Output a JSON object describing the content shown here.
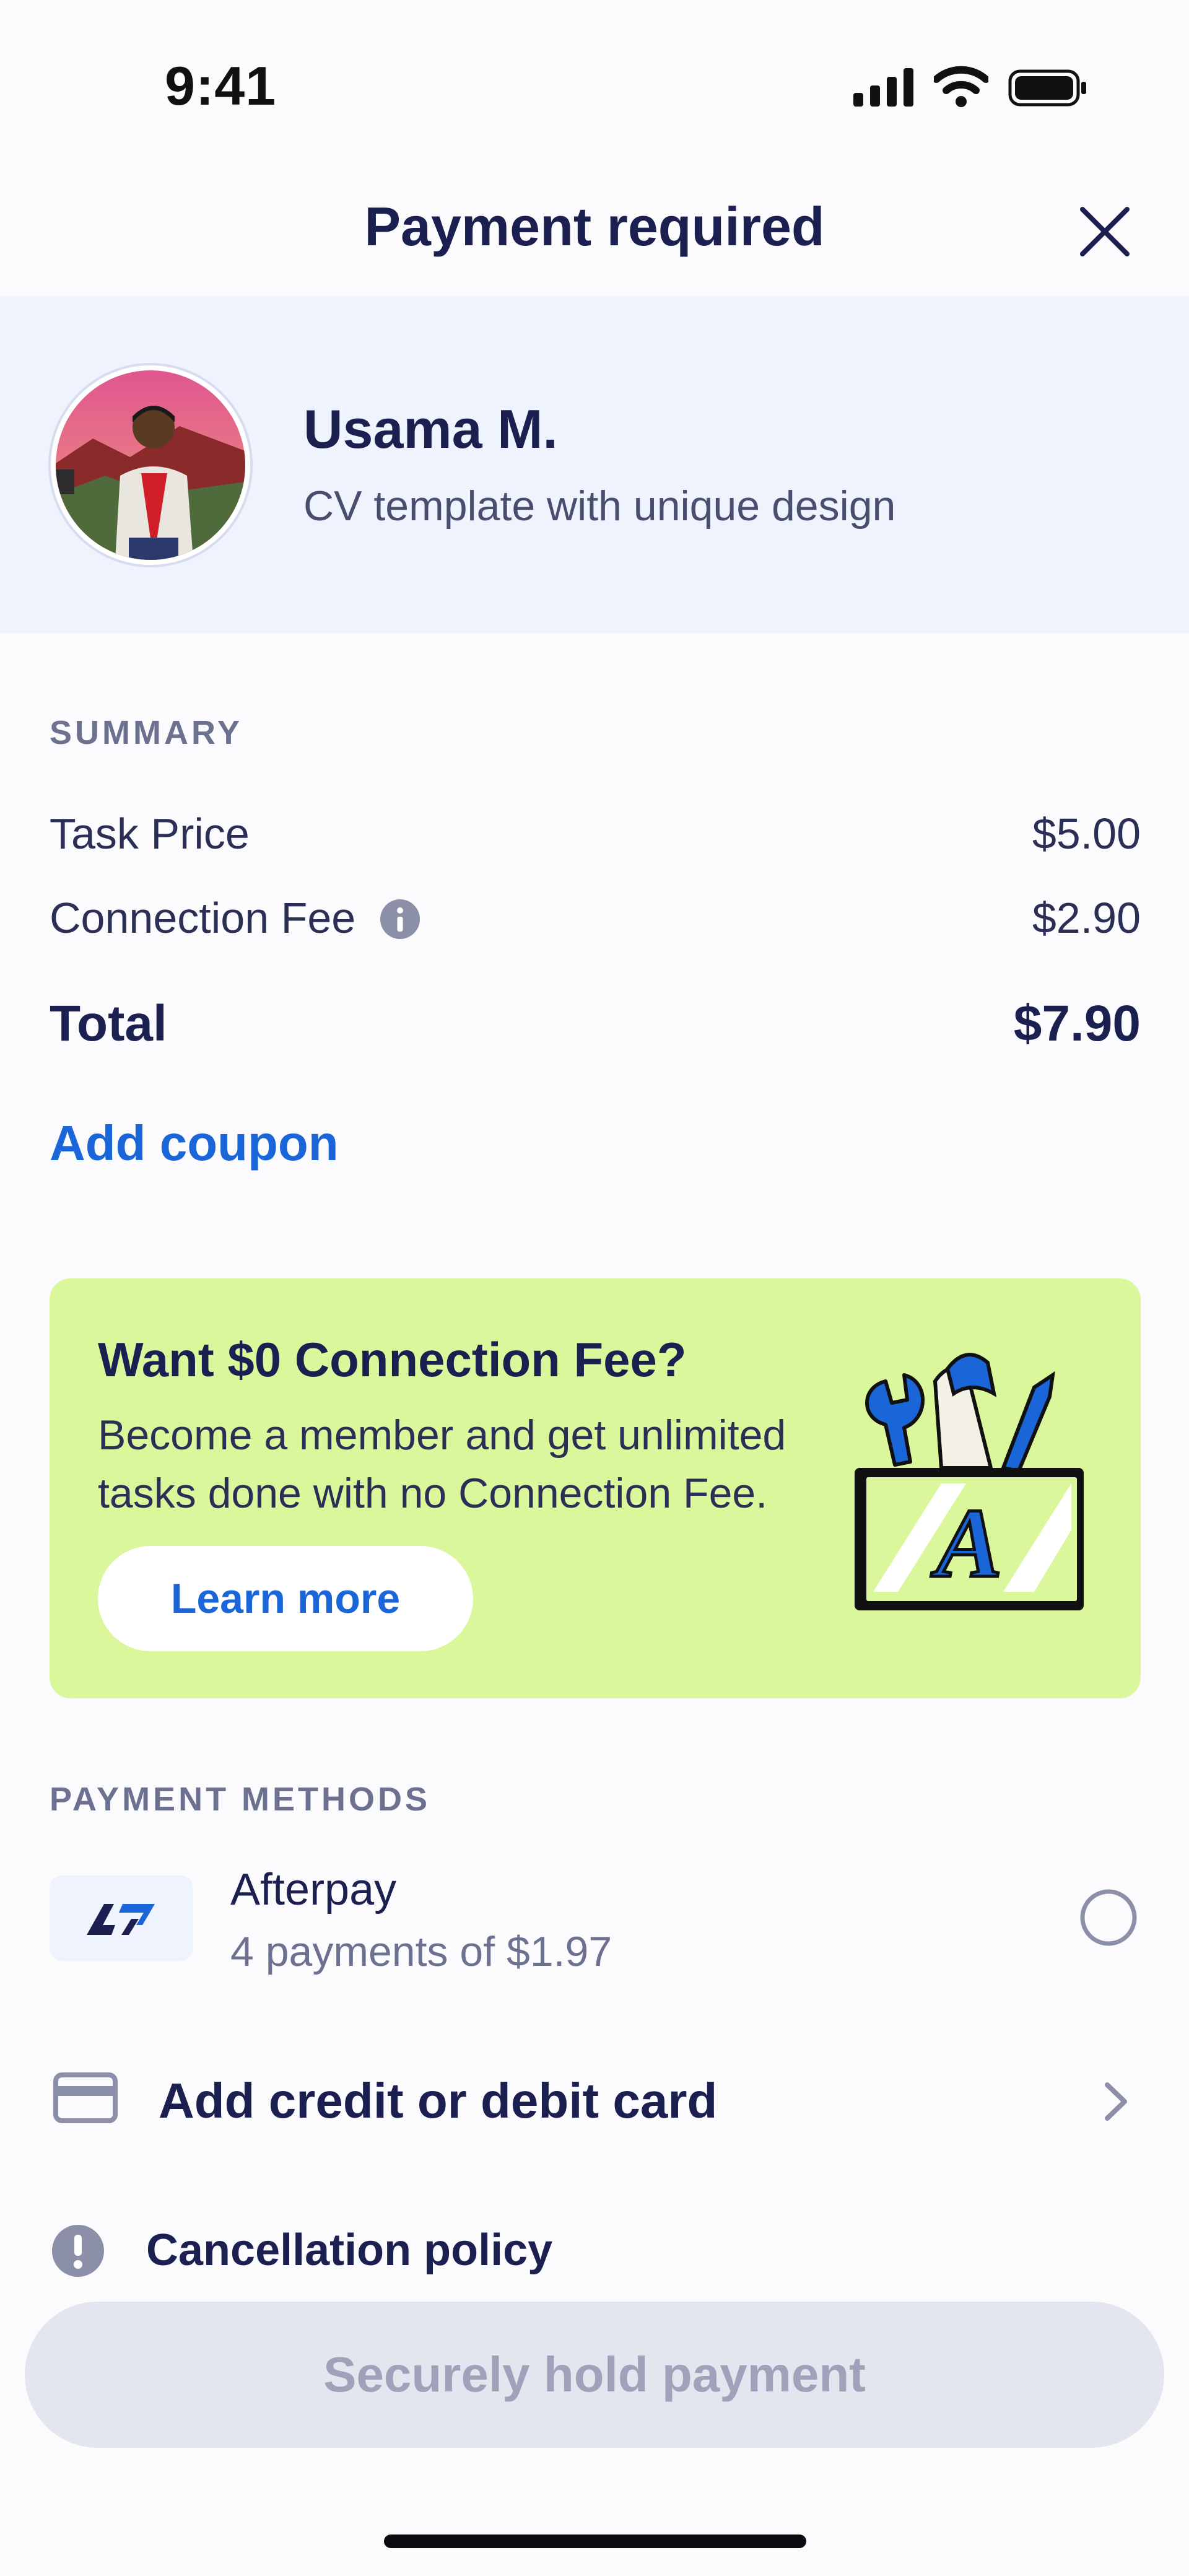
{
  "status_bar": {
    "time": "9:41"
  },
  "header": {
    "title": "Payment required"
  },
  "profile": {
    "name": "Usama M.",
    "task": "CV template with unique design"
  },
  "summary": {
    "label": "SUMMARY",
    "rows": [
      {
        "label": "Task Price",
        "value": "$5.00"
      },
      {
        "label": "Connection Fee",
        "value": "$2.90"
      }
    ],
    "total_label": "Total",
    "total_value": "$7.90",
    "coupon": "Add coupon"
  },
  "promo": {
    "title": "Want $0 Connection Fee?",
    "body": "Become a member and get unlimited tasks done with no Connection Fee.",
    "button": "Learn more"
  },
  "payment_methods": {
    "label": "PAYMENT METHODS",
    "afterpay": {
      "name": "Afterpay",
      "detail": "4 payments of $1.97"
    },
    "add_card": "Add credit or debit card"
  },
  "cancellation": "Cancellation policy",
  "cta": "Securely hold payment",
  "colors": {
    "accent": "#1a66d9",
    "promo_bg": "#daf79c",
    "profile_bg": "#eef3fd",
    "text_dark": "#1c2050"
  }
}
